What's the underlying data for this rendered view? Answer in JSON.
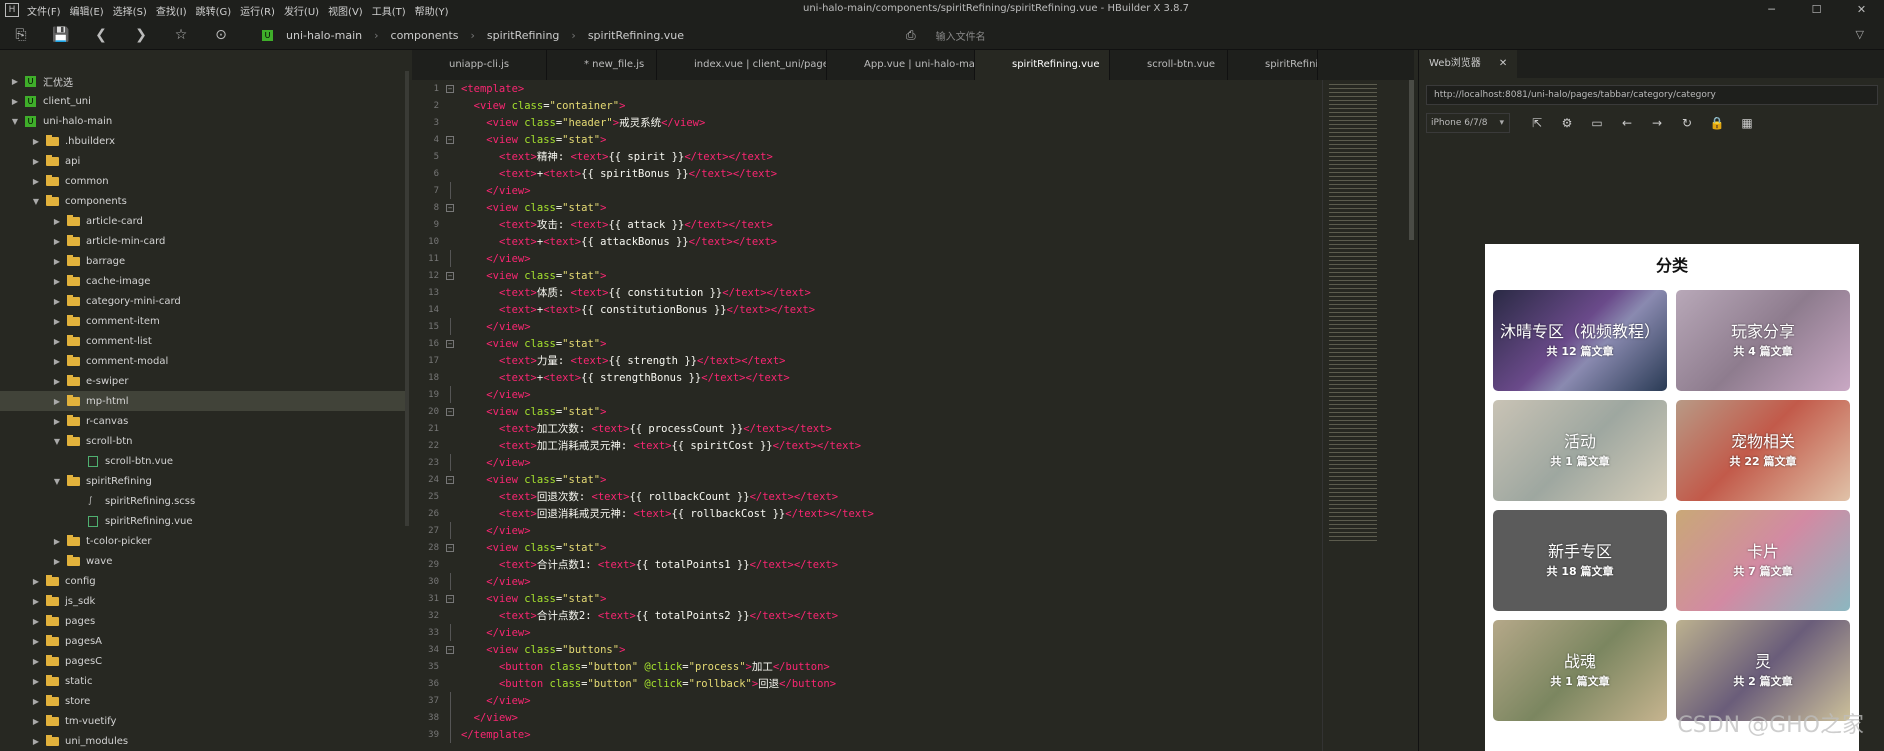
{
  "window": {
    "title": "uni-halo-main/components/spiritRefining/spiritRefining.vue - HBuilder X 3.8.7"
  },
  "menu": [
    "文件(F)",
    "编辑(E)",
    "选择(S)",
    "查找(I)",
    "跳转(G)",
    "运行(R)",
    "发行(U)",
    "视图(V)",
    "工具(T)",
    "帮助(Y)"
  ],
  "breadcrumb": [
    "uni-halo-main",
    "components",
    "spiritRefining",
    "spiritRefining.vue"
  ],
  "file_search": {
    "placeholder": "输入文件名"
  },
  "tree": [
    {
      "label": "汇优选",
      "depth": 0,
      "type": "project",
      "exp": false
    },
    {
      "label": "client_uni",
      "depth": 0,
      "type": "project",
      "exp": false
    },
    {
      "label": "uni-halo-main",
      "depth": 0,
      "type": "project",
      "exp": true
    },
    {
      "label": ".hbuilderx",
      "depth": 1,
      "type": "folder",
      "exp": false
    },
    {
      "label": "api",
      "depth": 1,
      "type": "folder",
      "exp": false
    },
    {
      "label": "common",
      "depth": 1,
      "type": "folder",
      "exp": false
    },
    {
      "label": "components",
      "depth": 1,
      "type": "folder",
      "exp": true
    },
    {
      "label": "article-card",
      "depth": 2,
      "type": "folder",
      "exp": false
    },
    {
      "label": "article-min-card",
      "depth": 2,
      "type": "folder",
      "exp": false
    },
    {
      "label": "barrage",
      "depth": 2,
      "type": "folder",
      "exp": false
    },
    {
      "label": "cache-image",
      "depth": 2,
      "type": "folder",
      "exp": false
    },
    {
      "label": "category-mini-card",
      "depth": 2,
      "type": "folder",
      "exp": false
    },
    {
      "label": "comment-item",
      "depth": 2,
      "type": "folder",
      "exp": false
    },
    {
      "label": "comment-list",
      "depth": 2,
      "type": "folder",
      "exp": false
    },
    {
      "label": "comment-modal",
      "depth": 2,
      "type": "folder",
      "exp": false
    },
    {
      "label": "e-swiper",
      "depth": 2,
      "type": "folder",
      "exp": false
    },
    {
      "label": "mp-html",
      "depth": 2,
      "type": "folder",
      "exp": false,
      "selected": true
    },
    {
      "label": "r-canvas",
      "depth": 2,
      "type": "folder",
      "exp": false
    },
    {
      "label": "scroll-btn",
      "depth": 2,
      "type": "folder",
      "exp": true
    },
    {
      "label": "scroll-btn.vue",
      "depth": 3,
      "type": "file"
    },
    {
      "label": "spiritRefining",
      "depth": 2,
      "type": "folder",
      "exp": true
    },
    {
      "label": "spiritRefining.scss",
      "depth": 3,
      "type": "sass"
    },
    {
      "label": "spiritRefining.vue",
      "depth": 3,
      "type": "file"
    },
    {
      "label": "t-color-picker",
      "depth": 2,
      "type": "folder",
      "exp": false
    },
    {
      "label": "wave",
      "depth": 2,
      "type": "folder",
      "exp": false
    },
    {
      "label": "config",
      "depth": 1,
      "type": "folder",
      "exp": false
    },
    {
      "label": "js_sdk",
      "depth": 1,
      "type": "folder",
      "exp": false
    },
    {
      "label": "pages",
      "depth": 1,
      "type": "folder",
      "exp": false
    },
    {
      "label": "pagesA",
      "depth": 1,
      "type": "folder",
      "exp": false
    },
    {
      "label": "pagesC",
      "depth": 1,
      "type": "folder",
      "exp": false
    },
    {
      "label": "static",
      "depth": 1,
      "type": "folder",
      "exp": false
    },
    {
      "label": "store",
      "depth": 1,
      "type": "folder",
      "exp": false
    },
    {
      "label": "tm-vuetify",
      "depth": 1,
      "type": "folder",
      "exp": false
    },
    {
      "label": "uni_modules",
      "depth": 1,
      "type": "folder",
      "exp": false
    }
  ],
  "tabs": [
    {
      "label": "uniapp-cli.js"
    },
    {
      "label": "* new_file.js"
    },
    {
      "label": "index.vue | client_uni/pages/index"
    },
    {
      "label": "App.vue | uni-halo-main"
    },
    {
      "label": "spiritRefining.vue",
      "active": true
    },
    {
      "label": "scroll-btn.vue"
    },
    {
      "label": "spiritRefini"
    }
  ],
  "code": [
    {
      "n": "1",
      "f": "o",
      "s": [
        [
          "t",
          "<template>"
        ]
      ]
    },
    {
      "n": "2",
      "f": "",
      "s": [
        [
          "p",
          "  "
        ],
        [
          "t",
          "<view "
        ],
        [
          "a",
          "class"
        ],
        [
          "p",
          "="
        ],
        [
          "s",
          "\"container\""
        ],
        [
          "t",
          ">"
        ]
      ]
    },
    {
      "n": "3",
      "f": "",
      "s": [
        [
          "p",
          "    "
        ],
        [
          "t",
          "<view "
        ],
        [
          "a",
          "class"
        ],
        [
          "p",
          "="
        ],
        [
          "s",
          "\"header\""
        ],
        [
          "t",
          ">"
        ],
        [
          "p",
          "戒灵系统"
        ],
        [
          "t",
          "</view>"
        ]
      ]
    },
    {
      "n": "4",
      "f": "o",
      "s": [
        [
          "p",
          "    "
        ],
        [
          "t",
          "<view "
        ],
        [
          "a",
          "class"
        ],
        [
          "p",
          "="
        ],
        [
          "s",
          "\"stat\""
        ],
        [
          "t",
          ">"
        ]
      ]
    },
    {
      "n": "5",
      "f": "",
      "s": [
        [
          "p",
          "      "
        ],
        [
          "t",
          "<text>"
        ],
        [
          "p",
          "精神: "
        ],
        [
          "t",
          "<text>"
        ],
        [
          "p",
          "{{ spirit }}"
        ],
        [
          "t",
          "</text></text>"
        ]
      ]
    },
    {
      "n": "6",
      "f": "",
      "s": [
        [
          "p",
          "      "
        ],
        [
          "t",
          "<text>"
        ],
        [
          "p",
          "+"
        ],
        [
          "t",
          "<text>"
        ],
        [
          "p",
          "{{ spiritBonus }}"
        ],
        [
          "t",
          "</text></text>"
        ]
      ]
    },
    {
      "n": "7",
      "f": "c",
      "s": [
        [
          "p",
          "    "
        ],
        [
          "t",
          "</view>"
        ]
      ]
    },
    {
      "n": "8",
      "f": "o",
      "s": [
        [
          "p",
          "    "
        ],
        [
          "t",
          "<view "
        ],
        [
          "a",
          "class"
        ],
        [
          "p",
          "="
        ],
        [
          "s",
          "\"stat\""
        ],
        [
          "t",
          ">"
        ]
      ]
    },
    {
      "n": "9",
      "f": "",
      "s": [
        [
          "p",
          "      "
        ],
        [
          "t",
          "<text>"
        ],
        [
          "p",
          "攻击: "
        ],
        [
          "t",
          "<text>"
        ],
        [
          "p",
          "{{ attack }}"
        ],
        [
          "t",
          "</text></text>"
        ]
      ]
    },
    {
      "n": "10",
      "f": "",
      "s": [
        [
          "p",
          "      "
        ],
        [
          "t",
          "<text>"
        ],
        [
          "p",
          "+"
        ],
        [
          "t",
          "<text>"
        ],
        [
          "p",
          "{{ attackBonus }}"
        ],
        [
          "t",
          "</text></text>"
        ]
      ]
    },
    {
      "n": "11",
      "f": "c",
      "s": [
        [
          "p",
          "    "
        ],
        [
          "t",
          "</view>"
        ]
      ]
    },
    {
      "n": "12",
      "f": "o",
      "s": [
        [
          "p",
          "    "
        ],
        [
          "t",
          "<view "
        ],
        [
          "a",
          "class"
        ],
        [
          "p",
          "="
        ],
        [
          "s",
          "\"stat\""
        ],
        [
          "t",
          ">"
        ]
      ]
    },
    {
      "n": "13",
      "f": "",
      "s": [
        [
          "p",
          "      "
        ],
        [
          "t",
          "<text>"
        ],
        [
          "p",
          "体质: "
        ],
        [
          "t",
          "<text>"
        ],
        [
          "p",
          "{{ constitution }}"
        ],
        [
          "t",
          "</text></text>"
        ]
      ]
    },
    {
      "n": "14",
      "f": "",
      "s": [
        [
          "p",
          "      "
        ],
        [
          "t",
          "<text>"
        ],
        [
          "p",
          "+"
        ],
        [
          "t",
          "<text>"
        ],
        [
          "p",
          "{{ constitutionBonus }}"
        ],
        [
          "t",
          "</text></text>"
        ]
      ]
    },
    {
      "n": "15",
      "f": "c",
      "s": [
        [
          "p",
          "    "
        ],
        [
          "t",
          "</view>"
        ]
      ]
    },
    {
      "n": "16",
      "f": "o",
      "s": [
        [
          "p",
          "    "
        ],
        [
          "t",
          "<view "
        ],
        [
          "a",
          "class"
        ],
        [
          "p",
          "="
        ],
        [
          "s",
          "\"stat\""
        ],
        [
          "t",
          ">"
        ]
      ]
    },
    {
      "n": "17",
      "f": "",
      "s": [
        [
          "p",
          "      "
        ],
        [
          "t",
          "<text>"
        ],
        [
          "p",
          "力量: "
        ],
        [
          "t",
          "<text>"
        ],
        [
          "p",
          "{{ strength }}"
        ],
        [
          "t",
          "</text></text>"
        ]
      ]
    },
    {
      "n": "18",
      "f": "",
      "s": [
        [
          "p",
          "      "
        ],
        [
          "t",
          "<text>"
        ],
        [
          "p",
          "+"
        ],
        [
          "t",
          "<text>"
        ],
        [
          "p",
          "{{ strengthBonus }}"
        ],
        [
          "t",
          "</text></text>"
        ]
      ]
    },
    {
      "n": "19",
      "f": "c",
      "s": [
        [
          "p",
          "    "
        ],
        [
          "t",
          "</view>"
        ]
      ]
    },
    {
      "n": "20",
      "f": "o",
      "s": [
        [
          "p",
          "    "
        ],
        [
          "t",
          "<view "
        ],
        [
          "a",
          "class"
        ],
        [
          "p",
          "="
        ],
        [
          "s",
          "\"stat\""
        ],
        [
          "t",
          ">"
        ]
      ]
    },
    {
      "n": "21",
      "f": "",
      "s": [
        [
          "p",
          "      "
        ],
        [
          "t",
          "<text>"
        ],
        [
          "p",
          "加工次数: "
        ],
        [
          "t",
          "<text>"
        ],
        [
          "p",
          "{{ processCount }}"
        ],
        [
          "t",
          "</text></text>"
        ]
      ]
    },
    {
      "n": "22",
      "f": "",
      "s": [
        [
          "p",
          "      "
        ],
        [
          "t",
          "<text>"
        ],
        [
          "p",
          "加工消耗戒灵元神: "
        ],
        [
          "t",
          "<text>"
        ],
        [
          "p",
          "{{ spiritCost }}"
        ],
        [
          "t",
          "</text></text>"
        ]
      ]
    },
    {
      "n": "23",
      "f": "c",
      "s": [
        [
          "p",
          "    "
        ],
        [
          "t",
          "</view>"
        ]
      ]
    },
    {
      "n": "24",
      "f": "o",
      "s": [
        [
          "p",
          "    "
        ],
        [
          "t",
          "<view "
        ],
        [
          "a",
          "class"
        ],
        [
          "p",
          "="
        ],
        [
          "s",
          "\"stat\""
        ],
        [
          "t",
          ">"
        ]
      ]
    },
    {
      "n": "25",
      "f": "",
      "s": [
        [
          "p",
          "      "
        ],
        [
          "t",
          "<text>"
        ],
        [
          "p",
          "回退次数: "
        ],
        [
          "t",
          "<text>"
        ],
        [
          "p",
          "{{ rollbackCount }}"
        ],
        [
          "t",
          "</text></text>"
        ]
      ]
    },
    {
      "n": "26",
      "f": "",
      "s": [
        [
          "p",
          "      "
        ],
        [
          "t",
          "<text>"
        ],
        [
          "p",
          "回退消耗戒灵元神: "
        ],
        [
          "t",
          "<text>"
        ],
        [
          "p",
          "{{ rollbackCost }}"
        ],
        [
          "t",
          "</text></text>"
        ]
      ]
    },
    {
      "n": "27",
      "f": "c",
      "s": [
        [
          "p",
          "    "
        ],
        [
          "t",
          "</view>"
        ]
      ]
    },
    {
      "n": "28",
      "f": "o",
      "s": [
        [
          "p",
          "    "
        ],
        [
          "t",
          "<view "
        ],
        [
          "a",
          "class"
        ],
        [
          "p",
          "="
        ],
        [
          "s",
          "\"stat\""
        ],
        [
          "t",
          ">"
        ]
      ]
    },
    {
      "n": "29",
      "f": "",
      "s": [
        [
          "p",
          "      "
        ],
        [
          "t",
          "<text>"
        ],
        [
          "p",
          "合计点数1: "
        ],
        [
          "t",
          "<text>"
        ],
        [
          "p",
          "{{ totalPoints1 }}"
        ],
        [
          "t",
          "</text></text>"
        ]
      ]
    },
    {
      "n": "30",
      "f": "c",
      "s": [
        [
          "p",
          "    "
        ],
        [
          "t",
          "</view>"
        ]
      ]
    },
    {
      "n": "31",
      "f": "o",
      "s": [
        [
          "p",
          "    "
        ],
        [
          "t",
          "<view "
        ],
        [
          "a",
          "class"
        ],
        [
          "p",
          "="
        ],
        [
          "s",
          "\"stat\""
        ],
        [
          "t",
          ">"
        ]
      ]
    },
    {
      "n": "32",
      "f": "",
      "s": [
        [
          "p",
          "      "
        ],
        [
          "t",
          "<text>"
        ],
        [
          "p",
          "合计点数2: "
        ],
        [
          "t",
          "<text>"
        ],
        [
          "p",
          "{{ totalPoints2 }}"
        ],
        [
          "t",
          "</text></text>"
        ]
      ]
    },
    {
      "n": "33",
      "f": "c",
      "s": [
        [
          "p",
          "    "
        ],
        [
          "t",
          "</view>"
        ]
      ]
    },
    {
      "n": "34",
      "f": "o",
      "s": [
        [
          "p",
          "    "
        ],
        [
          "t",
          "<view "
        ],
        [
          "a",
          "class"
        ],
        [
          "p",
          "="
        ],
        [
          "s",
          "\"buttons\""
        ],
        [
          "t",
          ">"
        ]
      ]
    },
    {
      "n": "35",
      "f": "",
      "s": [
        [
          "p",
          "      "
        ],
        [
          "t",
          "<button "
        ],
        [
          "a",
          "class"
        ],
        [
          "p",
          "="
        ],
        [
          "s",
          "\"button\" "
        ],
        [
          "a",
          "@click"
        ],
        [
          "p",
          "="
        ],
        [
          "s",
          "\"process\""
        ],
        [
          "t",
          ">"
        ],
        [
          "p",
          "加工"
        ],
        [
          "t",
          "</button>"
        ]
      ]
    },
    {
      "n": "36",
      "f": "",
      "s": [
        [
          "p",
          "      "
        ],
        [
          "t",
          "<button "
        ],
        [
          "a",
          "class"
        ],
        [
          "p",
          "="
        ],
        [
          "s",
          "\"button\" "
        ],
        [
          "a",
          "@click"
        ],
        [
          "p",
          "="
        ],
        [
          "s",
          "\"rollback\""
        ],
        [
          "t",
          ">"
        ],
        [
          "p",
          "回退"
        ],
        [
          "t",
          "</button>"
        ]
      ]
    },
    {
      "n": "37",
      "f": "c",
      "s": [
        [
          "p",
          "    "
        ],
        [
          "t",
          "</view>"
        ]
      ]
    },
    {
      "n": "38",
      "f": "c",
      "s": [
        [
          "p",
          "  "
        ],
        [
          "t",
          "</view>"
        ]
      ]
    },
    {
      "n": "39",
      "f": "c",
      "s": [
        [
          "t",
          "</template>"
        ]
      ]
    }
  ],
  "browser": {
    "tab_label": "Web浏览器",
    "url": "http://localhost:8081/uni-halo/pages/tabbar/category/category",
    "device": "iPhone 6/7/8",
    "page_title": "分类",
    "cards": [
      {
        "title": "沐晴专区（视频教程）",
        "count": "共 12 篇文章",
        "bg": "bg1"
      },
      {
        "title": "玩家分享",
        "count": "共 4 篇文章",
        "bg": "bg2"
      },
      {
        "title": "活动",
        "count": "共 1 篇文章",
        "bg": "bg3"
      },
      {
        "title": "宠物相关",
        "count": "共 22 篇文章",
        "bg": "bg4"
      },
      {
        "title": "新手专区",
        "count": "共 18 篇文章",
        "bg": "bg5"
      },
      {
        "title": "卡片",
        "count": "共 7 篇文章",
        "bg": "bg6"
      },
      {
        "title": "战魂",
        "count": "共 1 篇文章",
        "bg": "bg7"
      },
      {
        "title": "灵",
        "count": "共 2 篇文章",
        "bg": "bg8"
      }
    ]
  },
  "watermark": "CSDN @GHO之家"
}
